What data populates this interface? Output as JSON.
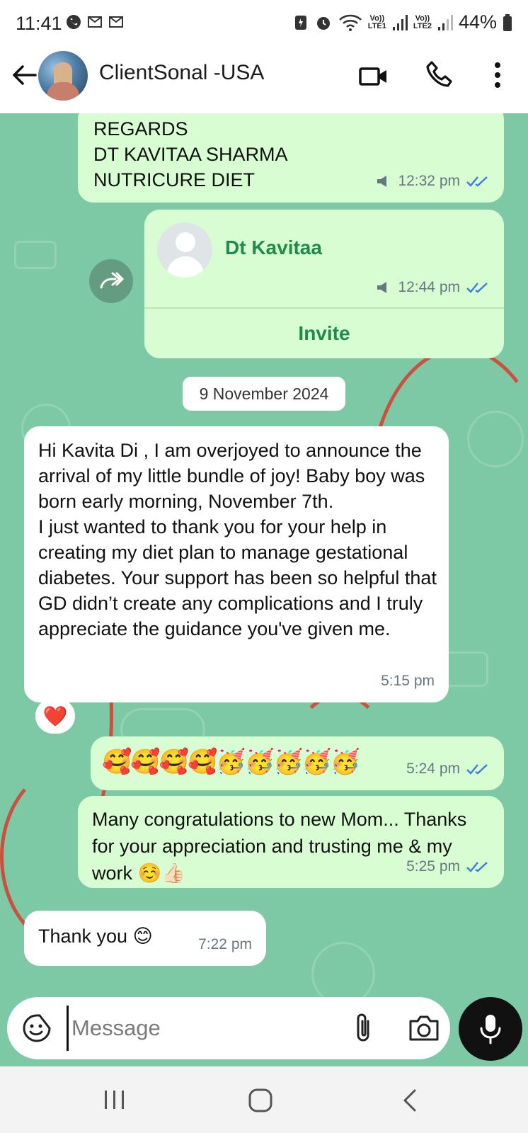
{
  "status_bar": {
    "time": "11:41",
    "left_icons": [
      "whatsapp-icon",
      "gmail-icon",
      "gmail-icon"
    ],
    "sim1_top": "Vo))",
    "sim1_bottom": "LTE1",
    "sim2_top": "Vo))",
    "sim2_bottom": "LTE2",
    "battery": "44%"
  },
  "header": {
    "contact_name": "ClientSonal -USA",
    "icons": [
      "back-arrow-icon",
      "video-call-icon",
      "phone-call-icon",
      "more-options-icon"
    ]
  },
  "messages": [
    {
      "direction": "outgoing",
      "lines": [
        "REGARDS",
        "DT KAVITAA SHARMA",
        "NUTRICURE DIET"
      ],
      "time": "12:32 pm",
      "broadcast": true,
      "read": true
    },
    {
      "direction": "outgoing",
      "type": "contact_card",
      "forwarded": true,
      "contact_name": "Dt Kavitaa",
      "time": "12:44 pm",
      "broadcast": true,
      "read": true,
      "action": "Invite"
    },
    {
      "type": "date",
      "text": "9 November 2024"
    },
    {
      "direction": "incoming",
      "text": "Hi Kavita Di , I am overjoyed to announce the arrival of my little bundle of joy! Baby boy was born early morning, November 7th.\nI just wanted to thank you for your help in creating my diet plan to manage gestational diabetes. Your support has been so helpful that GD didn’t create any complications and I truly appreciate the guidance you've given me.",
      "time": "5:15 pm",
      "reaction": "❤️"
    },
    {
      "direction": "outgoing",
      "text": "🥰🥰🥰🥰🥳🥳🥳🥳🥳",
      "time": "5:24 pm",
      "read": true
    },
    {
      "direction": "outgoing",
      "text": "Many congratulations to new Mom... Thanks for your appreciation and trusting me & my work ☺️👍🏻",
      "time": "5:25 pm",
      "read": true
    },
    {
      "direction": "incoming",
      "text": "Thank you 😊",
      "time": "7:22 pm"
    }
  ],
  "composer": {
    "placeholder": "Message",
    "value": ""
  },
  "colors": {
    "chat_background": "#7dc8a5",
    "outgoing_bubble": "#d9fdd3",
    "incoming_bubble": "#ffffff",
    "accent_green": "#1f8a4c",
    "read_ticks": "#53bdeb"
  }
}
